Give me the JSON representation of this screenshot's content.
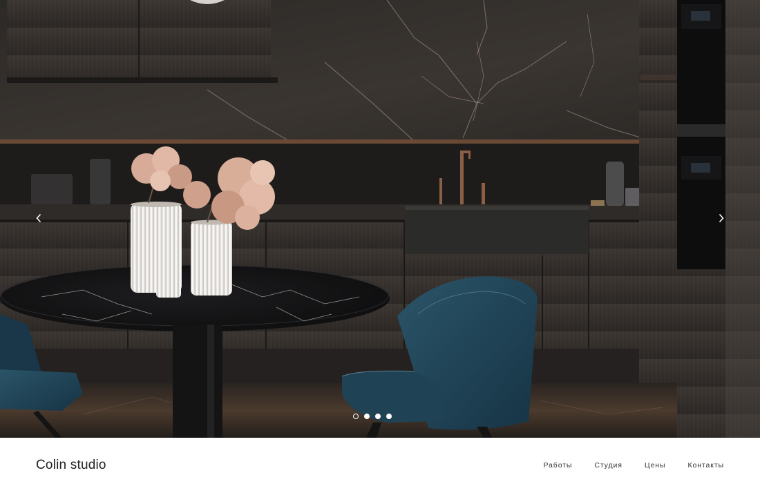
{
  "brand": {
    "name": "Colin studio"
  },
  "nav": {
    "items": [
      {
        "label": "Работы"
      },
      {
        "label": "Студия"
      },
      {
        "label": "Цены"
      },
      {
        "label": "Контакты"
      }
    ]
  },
  "slider": {
    "total_slides": 4,
    "active_slide": 1
  },
  "icons": {
    "prev": "chevron-left-icon",
    "next": "chevron-right-icon"
  },
  "colors": {
    "accent_text": "#222222",
    "background": "#ffffff",
    "hero_dark": "#1f1d1b"
  }
}
